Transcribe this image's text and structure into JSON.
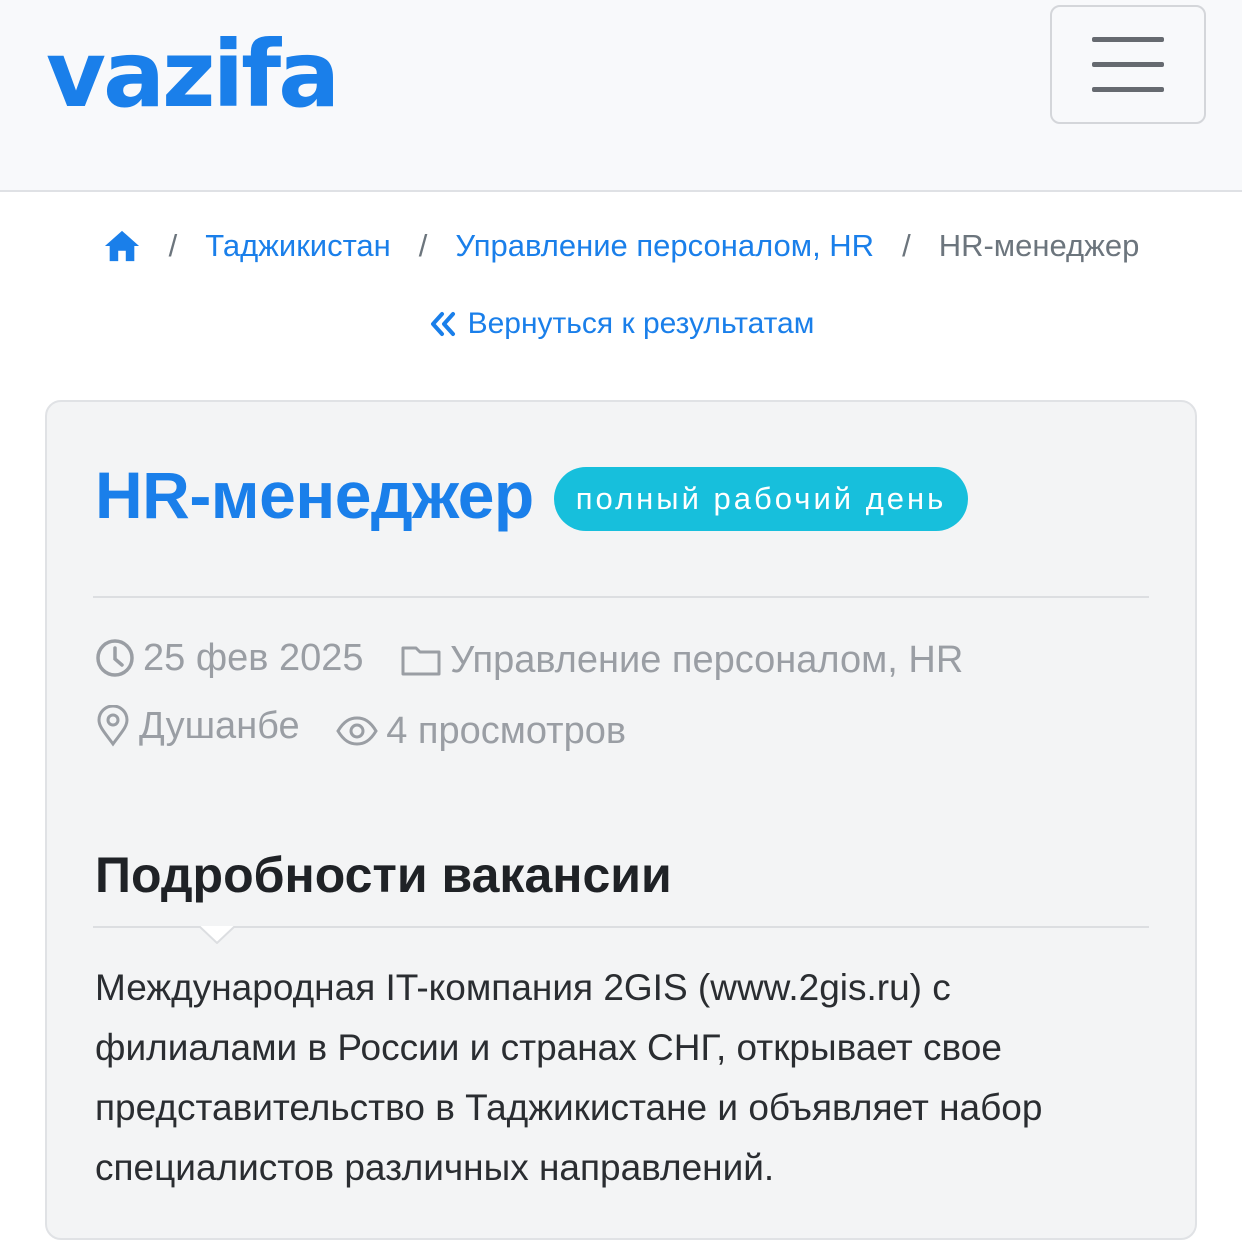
{
  "header": {
    "logo": "vazifa",
    "menu_icon": "hamburger-icon"
  },
  "breadcrumb": {
    "home_icon": "home-icon",
    "items": [
      "Таджикистан",
      "Управление персоналом, HR"
    ],
    "current": "HR-менеджер",
    "separator": "/"
  },
  "back_link": {
    "icon": "double-chevron-left-icon",
    "label": "Вернуться к результатам"
  },
  "job": {
    "title": "HR-менеджер",
    "badge": "полный рабочий день",
    "meta": {
      "date": "25 фев 2025",
      "category": "Управление персоналом, HR",
      "location": "Душанбе",
      "views": "4 просмотров"
    },
    "section_title": "Подробности вакансии",
    "description": "Международная IT-компания 2GIS (www.2gis.ru) с филиалами в России и странах СНГ, открывает свое представительство в Таджикистане и объявляет набор специалистов различных направлений."
  },
  "colors": {
    "brand": "#1a7fea",
    "badge": "#17bfdc",
    "muted": "#9a9ea4"
  }
}
